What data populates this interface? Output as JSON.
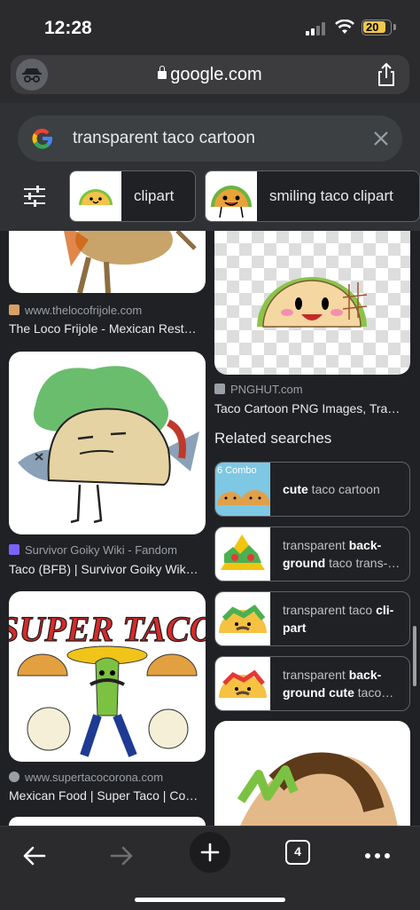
{
  "status_bar": {
    "time": "12:28",
    "battery": "20"
  },
  "url_bar": {
    "domain": "google.com"
  },
  "search": {
    "query": "transparent taco cartoon"
  },
  "chips": [
    {
      "label": "clipart"
    },
    {
      "label": "smiling taco clipart"
    }
  ],
  "results": {
    "left": [
      {
        "source": "www.thelocofrijole.com",
        "caption": "The Loco Frijole - Mexican Rest…"
      },
      {
        "source": "Survivor Goiky Wiki - Fandom",
        "caption": "Taco (BFB) | Survivor Goiky Wik…"
      },
      {
        "source": "www.supertacocorona.com",
        "caption": "Mexican Food | Super Taco | Co…",
        "image_text": "SUPER TACO"
      }
    ],
    "right": [
      {
        "source": "PNGHUT.com",
        "caption": "Taco Cartoon PNG Images, Tra…"
      }
    ]
  },
  "related": {
    "title": "Related searches",
    "items": [
      {
        "bold": "cute",
        "rest": " taco cartoon",
        "thumb_label": "6 Combo"
      },
      {
        "pre": "transparent ",
        "bold": "back-ground",
        "rest": " taco trans-…"
      },
      {
        "pre": "transparent taco ",
        "bold": "cli-part",
        "rest": ""
      },
      {
        "pre": "transparent ",
        "bold": "back-ground cute",
        "rest": " taco…"
      }
    ]
  },
  "toolbar": {
    "tab_count": "4"
  },
  "colors": {
    "background": "#202124",
    "header": "#303134",
    "accent_battery": "#f2c94c"
  }
}
